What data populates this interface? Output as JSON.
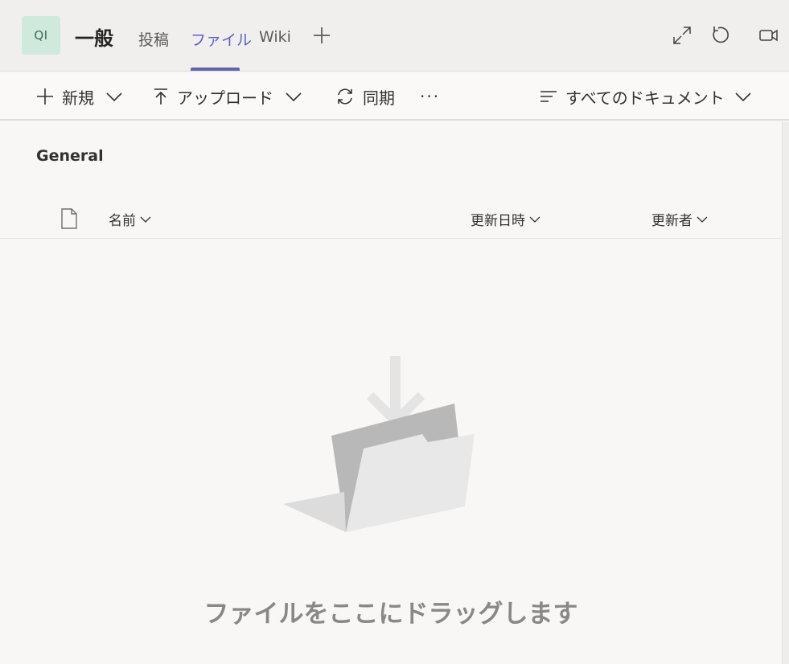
{
  "header": {
    "avatar_initials": "QI",
    "channel_title": "一般",
    "tabs": [
      {
        "label": "投稿",
        "active": false
      },
      {
        "label": "ファイル",
        "active": true
      },
      {
        "label": "Wiki",
        "active": false
      }
    ],
    "add_tab_icon": "plus-icon",
    "right_icons": [
      "expand-icon",
      "refresh-icon",
      "meet-icon"
    ],
    "accent_color": "#6264a7"
  },
  "toolbar": {
    "new_label": "新規",
    "upload_label": "アップロード",
    "sync_label": "同期",
    "more_label": "···",
    "view_label": "すべてのドキュメント"
  },
  "library": {
    "folder_name": "General",
    "columns": {
      "name": "名前",
      "modified": "更新日時",
      "modified_by": "更新者"
    },
    "empty_message": "ファイルをここにドラッグします"
  }
}
